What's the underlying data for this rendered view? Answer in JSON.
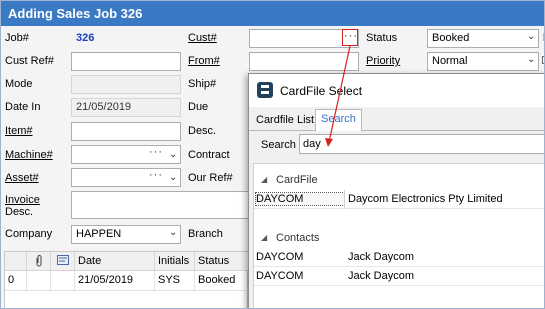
{
  "window": {
    "title": "Adding Sales Job 326"
  },
  "form": {
    "job_label": "Job#",
    "job_value": "326",
    "custref_label": "Cust Ref#",
    "mode_label": "Mode",
    "datein_label": "Date In",
    "datein_value": "21/05/2019",
    "item_label": "Item#",
    "machine_label": "Machine#",
    "asset_label": "Asset#",
    "invoice_label_1": "Invoice",
    "invoice_label_2": "Desc.",
    "company_label": "Company",
    "company_value": "HAPPEN",
    "cust_label": "Cust#",
    "from_label": "From#",
    "ship_label": "Ship#",
    "due_label": "Due",
    "desc_label": "Desc.",
    "contract_label": "Contract",
    "ourref_label": "Our Ref#",
    "branch_label": "Branch",
    "status_label": "Status",
    "status_value": "Booked",
    "priority_label": "Priority",
    "priority_value": "Normal",
    "ellipsis": "···"
  },
  "grid": {
    "headers": [
      "Date",
      "Initials",
      "Status"
    ],
    "rows": [
      {
        "num": "0",
        "date": "21/05/2019",
        "initials": "SYS",
        "status": "Booked"
      }
    ]
  },
  "dialog": {
    "title": "CardFile Select",
    "tabs": [
      "Cardfile List",
      "Search"
    ],
    "search_label": "Search",
    "search_value": "day",
    "groups": [
      {
        "name": "CardFile",
        "rows": [
          {
            "code": "DAYCOM",
            "name": "Daycom Electronics Pty Limited"
          }
        ]
      },
      {
        "name": "Contacts",
        "rows": [
          {
            "code": "DAYCOM",
            "name": "Jack Daycom"
          },
          {
            "code": "DAYCOM",
            "name": "Jack Daycom"
          }
        ]
      }
    ]
  },
  "colors": {
    "titlebar": "#3a79c4",
    "job_number": "#1a3fc4",
    "annotation": "#d92020"
  },
  "icons": [
    "paperclip-icon",
    "note-icon",
    "ellipsis-icon",
    "chevron-down-icon",
    "app-icon",
    "expand-triangle-icon",
    "arrow-annotation"
  ]
}
